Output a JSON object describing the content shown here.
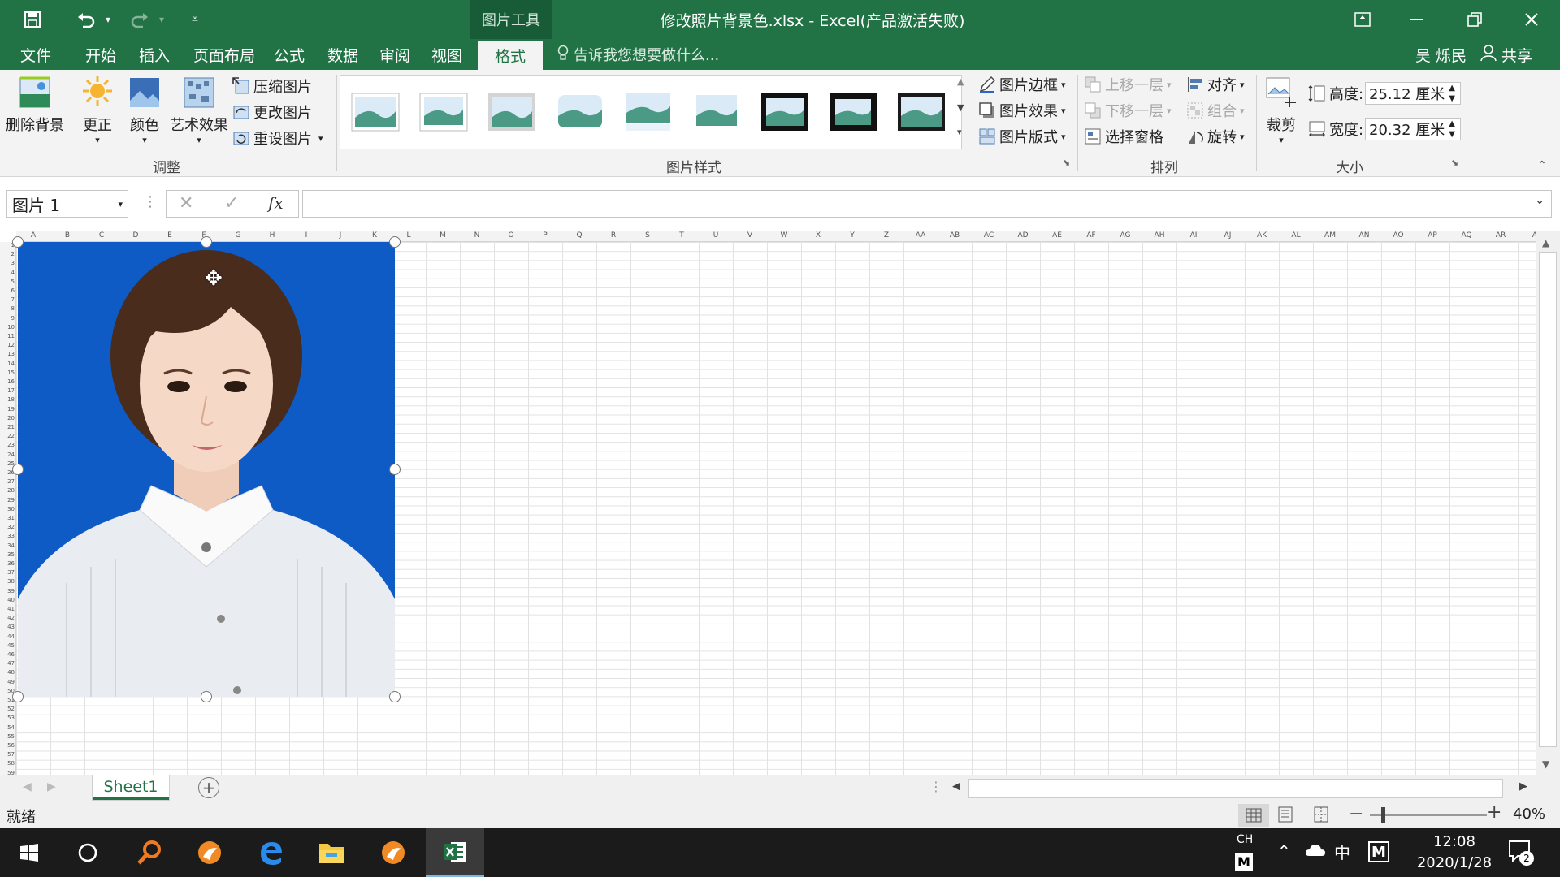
{
  "titlebar": {
    "context_tab": "图片工具",
    "window_title": "修改照片背景色.xlsx - Excel(产品激活失败)"
  },
  "menu": {
    "tabs": [
      "文件",
      "开始",
      "插入",
      "页面布局",
      "公式",
      "数据",
      "审阅",
      "视图",
      "格式"
    ],
    "active_tab": "格式",
    "tell_me": "告诉我您想要做什么...",
    "user": "吴 烁民",
    "share": "共享"
  },
  "ribbon": {
    "adjust": {
      "remove_bg": "删除背景",
      "corrections": "更正",
      "color": "颜色",
      "artistic": "艺术效果",
      "compress": "压缩图片",
      "change": "更改图片",
      "reset": "重设图片",
      "label": "调整"
    },
    "styles": {
      "label": "图片样式",
      "border": "图片边框",
      "effects": "图片效果",
      "layout": "图片版式"
    },
    "arrange": {
      "label": "排列",
      "bring_forward": "上移一层",
      "send_backward": "下移一层",
      "selection_pane": "选择窗格",
      "align": "对齐",
      "group": "组合",
      "rotate": "旋转"
    },
    "size": {
      "label": "大小",
      "crop": "裁剪",
      "height_label": "高度:",
      "height_value": "25.12 厘米",
      "width_label": "宽度:",
      "width_value": "20.32 厘米"
    }
  },
  "formula": {
    "name_box": "图片 1",
    "fx": "fx"
  },
  "columns": [
    "A",
    "B",
    "C",
    "D",
    "E",
    "F",
    "G",
    "H",
    "I",
    "J",
    "K",
    "L",
    "M",
    "N",
    "O",
    "P",
    "Q",
    "R",
    "S",
    "T",
    "U",
    "V",
    "W",
    "X",
    "Y",
    "Z",
    "AA",
    "AB",
    "AC",
    "AD",
    "AE",
    "AF",
    "AG",
    "AH",
    "AI",
    "AJ",
    "AK",
    "AL",
    "AM",
    "AN",
    "AO",
    "AP",
    "AQ",
    "AR",
    "A"
  ],
  "sheet": {
    "tab": "Sheet1"
  },
  "status": {
    "ready": "就绪",
    "zoom": "40%"
  },
  "taskbar": {
    "ime_top": "CH",
    "ime_mode": "中",
    "time": "12:08",
    "date": "2020/1/28",
    "notifications": "2"
  },
  "colors": {
    "excel_green": "#217346",
    "photo_blue": "#0e5bc6"
  }
}
